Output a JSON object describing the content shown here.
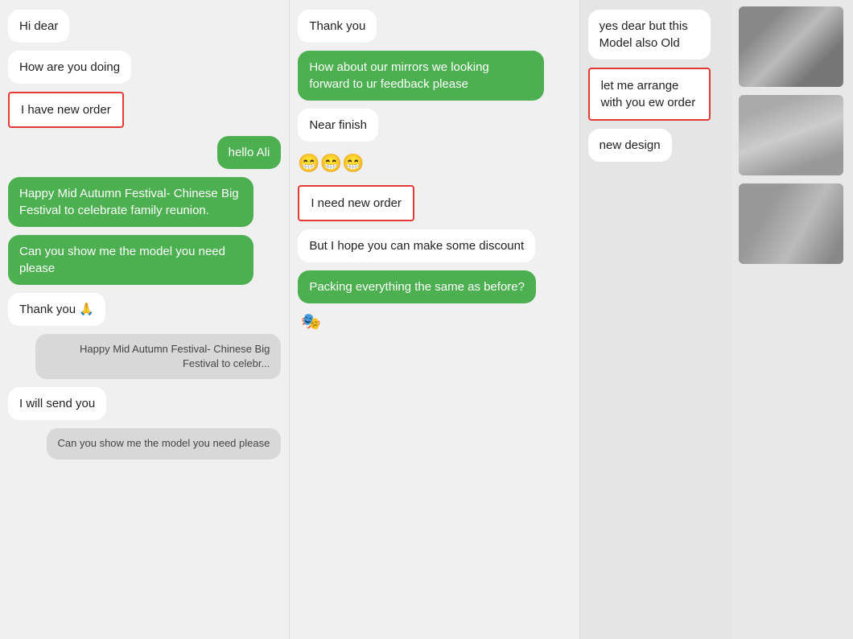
{
  "col1": {
    "messages": [
      {
        "id": "hi-dear",
        "text": "Hi dear",
        "type": "white"
      },
      {
        "id": "how-are-you",
        "text": "How are you doing",
        "type": "white"
      },
      {
        "id": "i-have-new-order",
        "text": "I have new order",
        "type": "outline-red"
      },
      {
        "id": "hello-ali",
        "text": "hello Ali",
        "type": "green-right"
      },
      {
        "id": "happy-festival",
        "text": "Happy Mid Autumn Festival- Chinese Big Festival to celebrate family reunion.",
        "type": "green"
      },
      {
        "id": "can-you-show",
        "text": "Can you show me the model you need please",
        "type": "green"
      },
      {
        "id": "thank-you-pray",
        "text": "Thank you 🙏",
        "type": "white"
      },
      {
        "id": "happy-festival-preview",
        "text": "Happy Mid Autumn Festival- Chinese Big Festival to celebr...",
        "type": "gray-right"
      },
      {
        "id": "i-will-send",
        "text": "I will send you",
        "type": "white"
      },
      {
        "id": "can-you-show-preview",
        "text": "Can you show me the model you need please",
        "type": "gray-right"
      }
    ]
  },
  "col2": {
    "messages": [
      {
        "id": "thank-you",
        "text": "Thank you",
        "type": "white"
      },
      {
        "id": "how-about-mirrors",
        "text": "How about our mirrors we looking forward to ur feedback please",
        "type": "green"
      },
      {
        "id": "near-finish",
        "text": "Near finish",
        "type": "white"
      },
      {
        "id": "emoji",
        "text": "😁😁😁",
        "type": "emoji"
      },
      {
        "id": "i-need-new-order",
        "text": "I need new order",
        "type": "outline-red"
      },
      {
        "id": "but-hope-discount",
        "text": "But I hope you can make some discount",
        "type": "white"
      },
      {
        "id": "packing-same",
        "text": "Packing everything the same as before?",
        "type": "green"
      },
      {
        "id": "sticker",
        "text": "🎭",
        "type": "sticker"
      }
    ]
  },
  "col3": {
    "messages": [
      {
        "id": "yes-dear-model-old",
        "text": "yes dear but this Model also Old",
        "type": "white"
      },
      {
        "id": "let-me-arrange",
        "text": "let me arrange with you ew order",
        "type": "outline-red-col3"
      },
      {
        "id": "new-design",
        "text": "new design",
        "type": "white"
      }
    ],
    "images": [
      {
        "id": "img1",
        "class": "img-mirror1"
      },
      {
        "id": "img2",
        "class": "img-mirror2"
      },
      {
        "id": "img3",
        "class": "img-mirror3"
      }
    ]
  }
}
